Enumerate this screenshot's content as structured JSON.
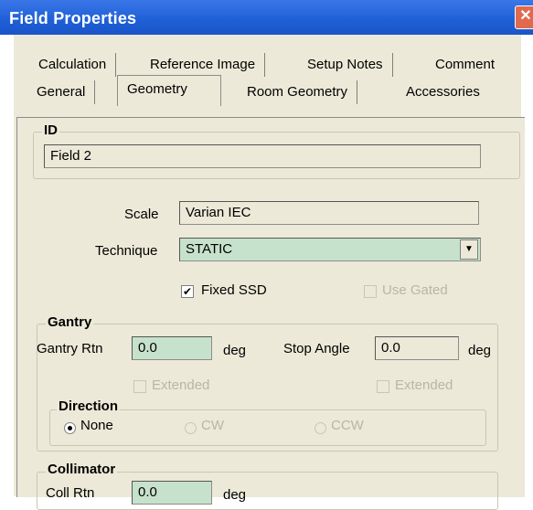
{
  "window": {
    "title": "Field Properties",
    "close_glyph": "✕"
  },
  "tabs": {
    "row1": [
      "Calculation",
      "Reference Image",
      "Setup Notes",
      "Comment"
    ],
    "row2": [
      "General",
      "Geometry",
      "Room Geometry",
      "Accessories"
    ],
    "active": "Geometry"
  },
  "id_group": {
    "label": "ID",
    "value": "Field 2"
  },
  "scale": {
    "label": "Scale",
    "value": "Varian IEC"
  },
  "technique": {
    "label": "Technique",
    "value": "STATIC",
    "arrow": "▼"
  },
  "fixed_ssd": {
    "label": "Fixed SSD",
    "checked": true,
    "mark": "✔"
  },
  "use_gated": {
    "label": "Use Gated",
    "checked": false,
    "enabled": false
  },
  "gantry": {
    "label": "Gantry",
    "rtn_label": "Gantry Rtn",
    "rtn_value": "0.0",
    "rtn_unit": "deg",
    "stop_label": "Stop Angle",
    "stop_value": "0.0",
    "stop_unit": "deg",
    "extended_left": "Extended",
    "extended_right": "Extended",
    "direction": {
      "label": "Direction",
      "options": [
        "None",
        "CW",
        "CCW"
      ],
      "selected": "None"
    }
  },
  "collimator": {
    "label": "Collimator",
    "rtn_label": "Coll Rtn",
    "rtn_value": "0.0",
    "rtn_unit": "deg"
  },
  "colors": {
    "titlebar": "#1e5fd6",
    "dialog": "#ece9d8",
    "input_active": "#c7e2cc",
    "disabled_text": "#b9b6a6"
  }
}
